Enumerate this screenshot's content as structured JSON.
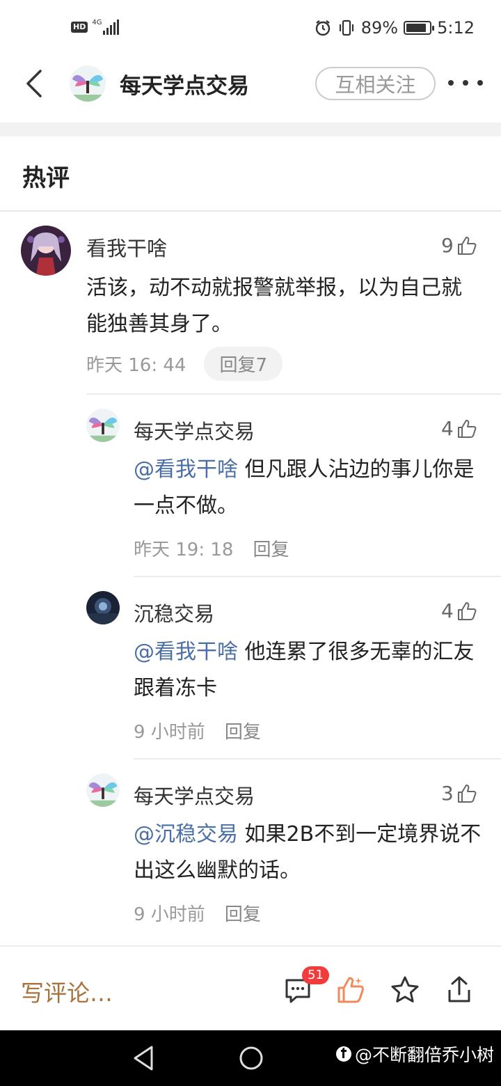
{
  "status_bar": {
    "hd": "HD",
    "network": "4G",
    "battery_percent": "89%",
    "battery_level": 0.89,
    "time": "5:12"
  },
  "header": {
    "title": "每天学点交易",
    "follow_label": "互相关注"
  },
  "section_title": "热评",
  "comment": {
    "author": "看我干啥",
    "likes": "9",
    "text": "活该，动不动就报警就举报，以为自己就能独善其身了。",
    "time": "昨天 16: 44",
    "reply_label": "回复7"
  },
  "replies": [
    {
      "author": "每天学点交易",
      "likes": "4",
      "mention": "@看我干啥",
      "text": " 但凡跟人沾边的事儿你是一点不做。",
      "time": "昨天 19: 18",
      "reply_label": "回复"
    },
    {
      "author": "沉稳交易",
      "likes": "4",
      "mention": "@看我干啥",
      "text": " 他连累了很多无辜的汇友跟着冻卡",
      "time": "9 小时前",
      "reply_label": "回复"
    },
    {
      "author": "每天学点交易",
      "likes": "3",
      "mention": "@沉稳交易",
      "text": " 如果2B不到一定境界说不出这么幽默的话。",
      "time": "9 小时前",
      "reply_label": "回复"
    }
  ],
  "action_bar": {
    "write_placeholder": "写评论…",
    "comment_count": "51"
  },
  "watermark": "@不断翻倍乔小树",
  "colors": {
    "mention": "#4a6fa5",
    "write_comment": "#a9713c",
    "like_active": "#f08a5d",
    "badge": "#f23c3c"
  },
  "icons": [
    "back-icon",
    "more-icon",
    "thumbs-up-icon",
    "comment-icon",
    "star-icon",
    "share-icon",
    "nav-back-icon",
    "nav-home-icon"
  ]
}
